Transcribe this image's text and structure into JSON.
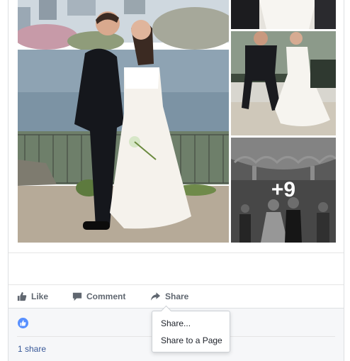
{
  "photos": {
    "more_count": "+9"
  },
  "actions": {
    "like_label": "Like",
    "comment_label": "Comment",
    "share_label": "Share"
  },
  "reactions": {
    "share_count": "1 share"
  },
  "share_menu": {
    "items": [
      "Share...",
      "Share to a Page"
    ]
  },
  "colors": {
    "link": "#385898",
    "like_blue": "#5890ff",
    "action_gray": "#606770"
  }
}
